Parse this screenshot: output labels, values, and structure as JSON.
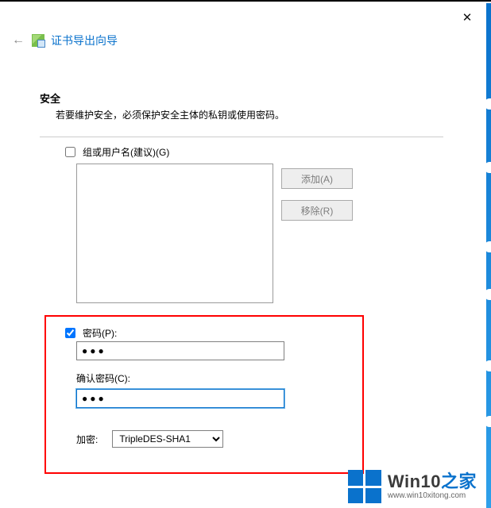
{
  "window": {
    "close_glyph": "✕"
  },
  "header": {
    "back_glyph": "←",
    "title": "证书导出向导"
  },
  "section": {
    "title": "安全",
    "desc": "若要维护安全，必须保护安全主体的私钥或使用密码。"
  },
  "groups": {
    "checkbox_label": "组或用户名(建议)(G)"
  },
  "buttons": {
    "add": "添加(A)",
    "remove": "移除(R)"
  },
  "password": {
    "checkbox_label": "密码(P):",
    "value": "●●●",
    "confirm_label": "确认密码(C):",
    "confirm_value": "●●●"
  },
  "encryption": {
    "label": "加密:",
    "value": "TripleDES-SHA1"
  },
  "watermark": {
    "brand_win": "Win10",
    "brand_suffix": "之家",
    "url": "www.win10xitong.com"
  }
}
